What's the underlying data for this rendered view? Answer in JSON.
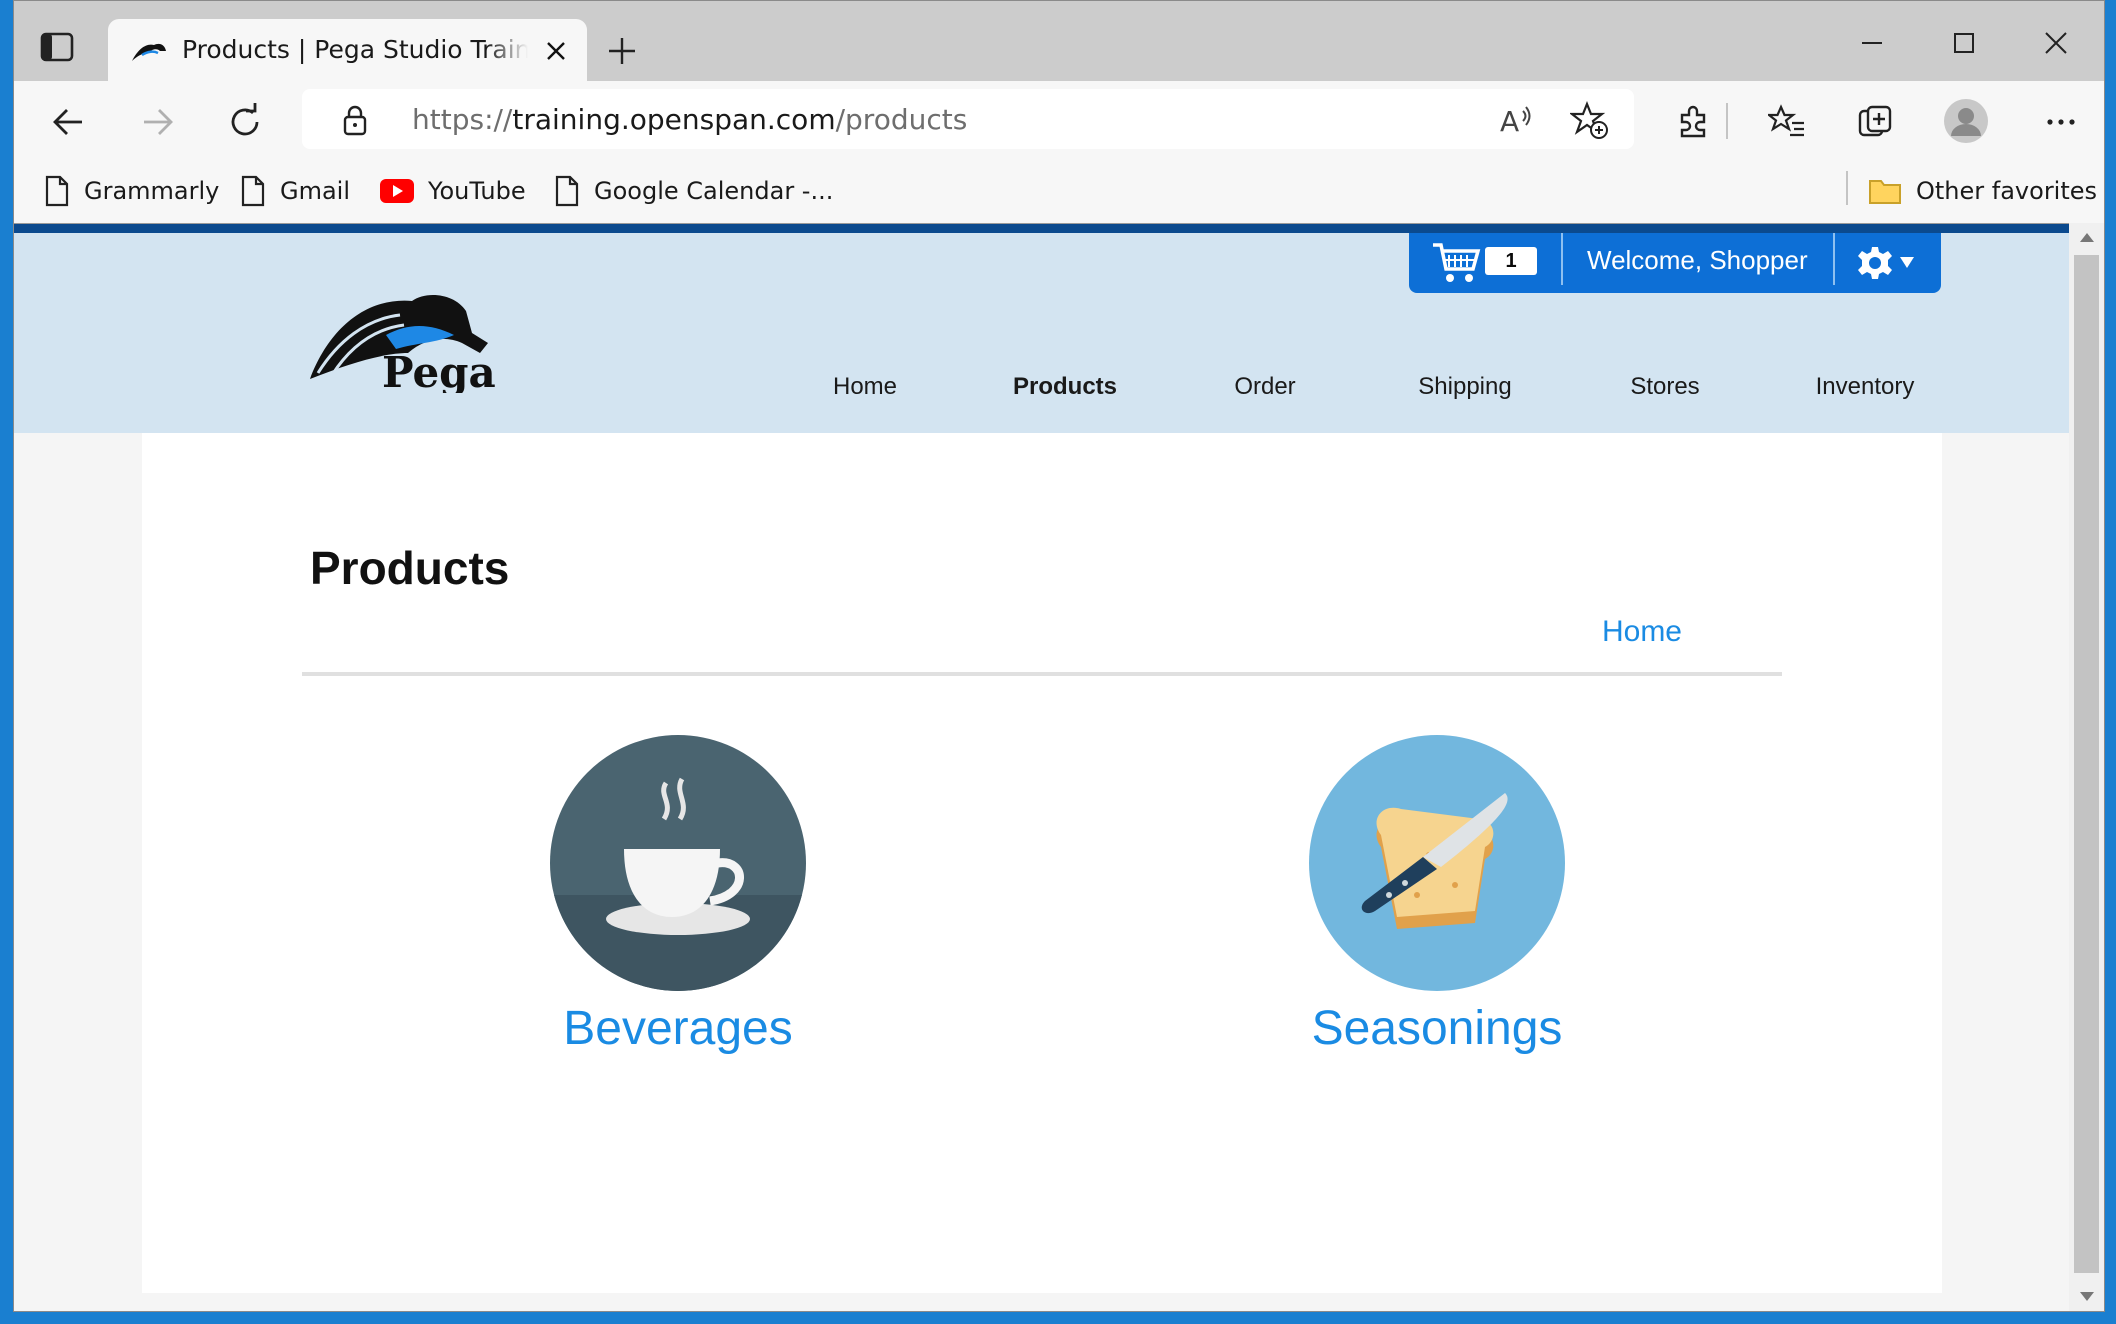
{
  "browser": {
    "tab_title": "Products | Pega Studio Training Website",
    "url_scheme": "https://",
    "url_host": "training.openspan.com",
    "url_path": "/products",
    "bookmarks": [
      {
        "label": "Grammarly",
        "icon": "page-icon"
      },
      {
        "label": "Gmail",
        "icon": "page-icon"
      },
      {
        "label": "YouTube",
        "icon": "youtube-icon"
      },
      {
        "label": "Google Calendar -...",
        "icon": "page-icon"
      }
    ],
    "other_favorites": "Other favorites"
  },
  "site": {
    "logo_text": "Pega",
    "cart_count": "1",
    "welcome": "Welcome, Shopper",
    "nav": [
      {
        "label": "Home",
        "active": false
      },
      {
        "label": "Products",
        "active": true
      },
      {
        "label": "Order",
        "active": false
      },
      {
        "label": "Shipping",
        "active": false
      },
      {
        "label": "Stores",
        "active": false
      },
      {
        "label": "Inventory",
        "active": false
      }
    ]
  },
  "page": {
    "title": "Products",
    "breadcrumb_home": "Home",
    "categories": [
      {
        "label": "Beverages",
        "icon": "coffee-cup-icon"
      },
      {
        "label": "Seasonings",
        "icon": "bread-knife-icon"
      }
    ]
  },
  "colors": {
    "header_bg": "#d3e4f1",
    "accent_blue": "#0d6fd6",
    "link_blue": "#1a8be3",
    "top_stripe": "#0b4a8e"
  }
}
